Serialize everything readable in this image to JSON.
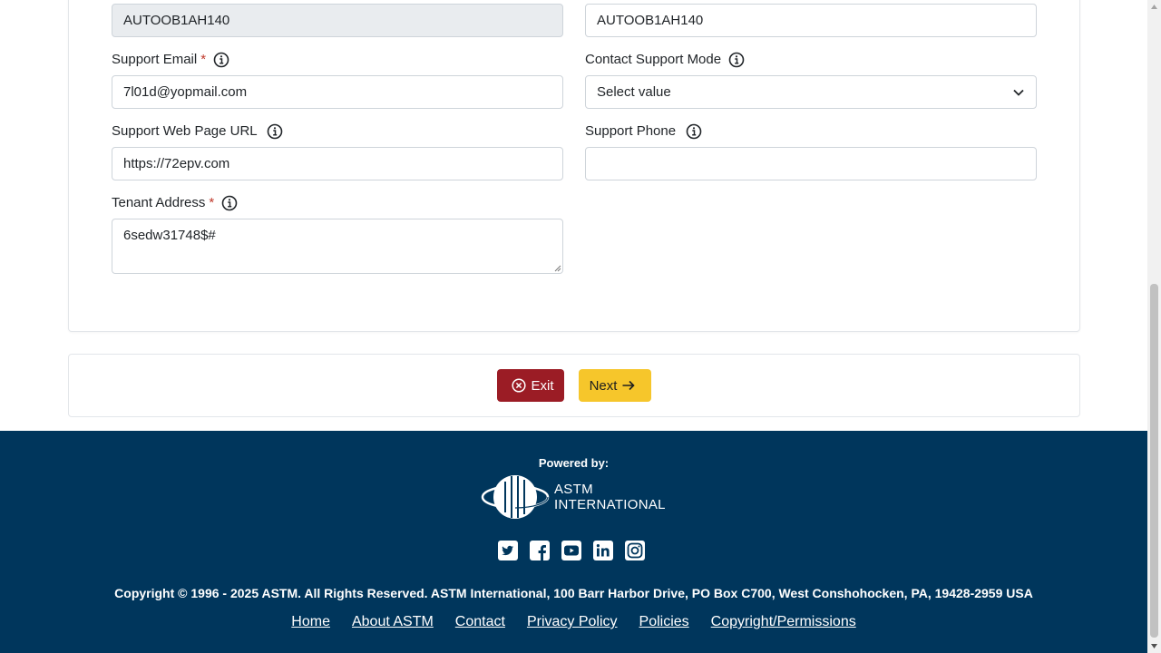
{
  "form": {
    "tenant_code_value": "AUTOOB1AH140",
    "tenant_name_value": "AUTOOB1AH140",
    "support_email": {
      "label": "Support Email",
      "required_mark": "*",
      "value": "7l01d@yopmail.com"
    },
    "contact_support_mode": {
      "label": "Contact Support Mode",
      "value": "Select value"
    },
    "support_web_url": {
      "label": "Support Web Page URL",
      "value": "https://72epv.com"
    },
    "support_phone": {
      "label": "Support Phone",
      "value": ""
    },
    "tenant_address": {
      "label": "Tenant Address",
      "required_mark": "*",
      "value": "6sedw31748$#"
    }
  },
  "actions": {
    "exit_label": "Exit",
    "next_label": "Next"
  },
  "footer": {
    "powered_by": "Powered by:",
    "logo_line1": "ASTM",
    "logo_line2": "INTERNATIONAL",
    "social_icons": [
      "twitter-icon",
      "facebook-icon",
      "youtube-icon",
      "linkedin-icon",
      "instagram-icon"
    ],
    "copyright": "Copyright © 1996 - 2025 ASTM. All Rights Reserved. ASTM International, 100 Barr Harbor Drive, PO Box C700, West Conshohocken, PA, 19428-2959 USA",
    "links": [
      "Home",
      "About ASTM",
      "Contact",
      "Privacy Policy",
      "Policies",
      "Copyright/Permissions"
    ]
  },
  "colors": {
    "exit": "#9b1c25",
    "next": "#f6c62b",
    "footer_bg": "#00365c",
    "required": "#c0392b"
  }
}
